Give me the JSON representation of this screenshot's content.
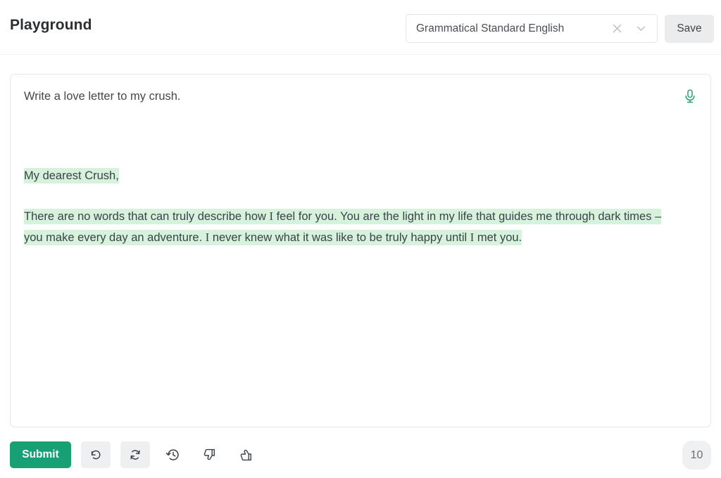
{
  "header": {
    "title": "Playground",
    "model_select": {
      "value": "Grammatical Standard English",
      "clear_icon": "close-x-icon",
      "expand_icon": "chevron-down-icon"
    },
    "save_label": "Save"
  },
  "editor": {
    "mic_icon": "microphone-icon",
    "prompt": "Write a love letter to my crush.",
    "completion": {
      "salutation": "My dearest Crush,",
      "paragraph_part1": "There are no words that can truly describe how ",
      "paragraph_i1": "I",
      "paragraph_part2": " feel for you. You are the light in my life that guides me through dark times – you make every day an adventure. ",
      "paragraph_i2": "I",
      "paragraph_part3": " never knew what it was like to be truly happy until ",
      "paragraph_i3": "I",
      "paragraph_part4": " met you.",
      "highlight_color": "#d6f2dc"
    }
  },
  "toolbar": {
    "submit_label": "Submit",
    "undo_icon": "undo-icon",
    "regenerate_icon": "refresh-icon",
    "history_icon": "history-clock-icon",
    "thumbs_down_icon": "thumbs-down-icon",
    "thumbs_up_icon": "thumbs-up-icon",
    "counter": "10"
  },
  "colors": {
    "accent_green": "#16a074",
    "mic_green": "#35a37a",
    "highlight_green": "#d6f2dc",
    "button_gray": "#ebecee",
    "text_dark": "#3b4248"
  }
}
